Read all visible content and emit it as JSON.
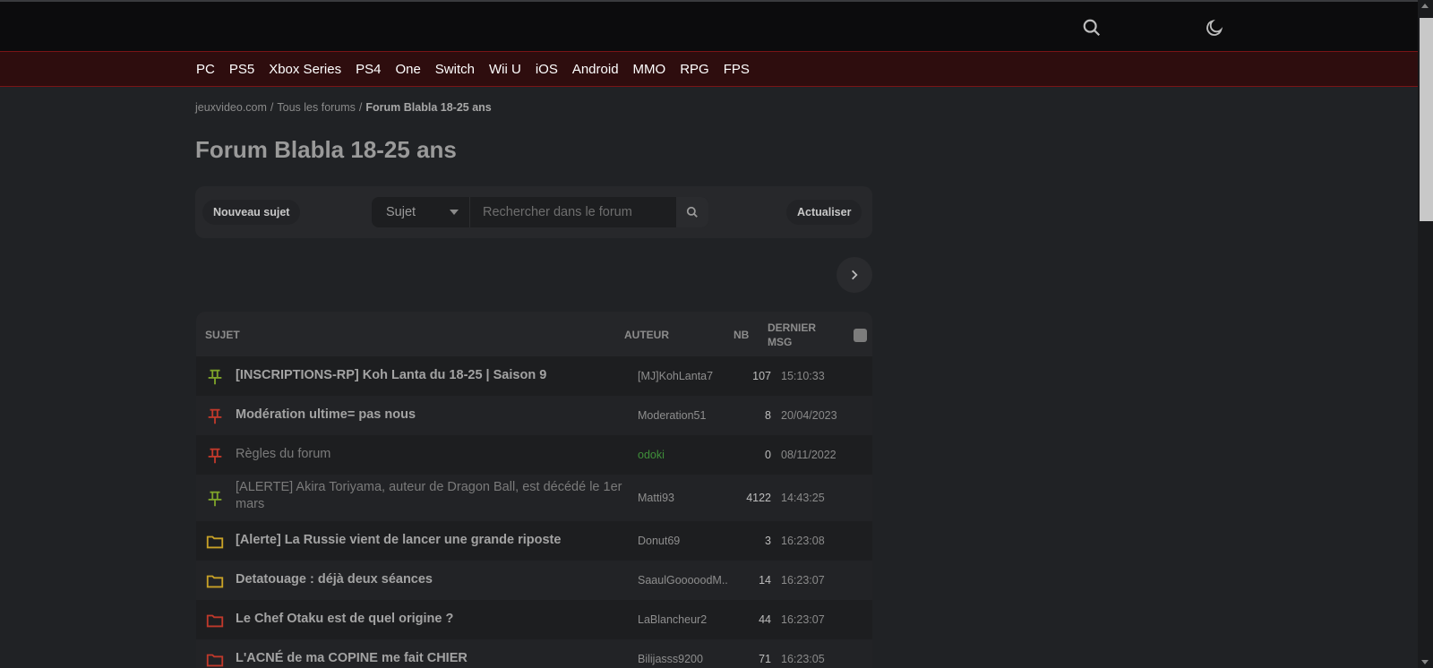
{
  "platforms": [
    "PC",
    "PS5",
    "Xbox Series",
    "PS4",
    "One",
    "Switch",
    "Wii U",
    "iOS",
    "Android",
    "MMO",
    "RPG",
    "FPS"
  ],
  "breadcrumb": {
    "home": "jeuxvideo.com",
    "sep": "/",
    "forums": "Tous les forums",
    "current": "Forum Blabla 18-25 ans"
  },
  "page_title": "Forum Blabla 18-25 ans",
  "actions": {
    "new_topic": "Nouveau sujet",
    "select_value": "Sujet",
    "search_placeholder": "Rechercher dans le forum",
    "refresh": "Actualiser"
  },
  "table": {
    "headers": {
      "subject": "SUJET",
      "author": "AUTEUR",
      "nb": "NB",
      "last_line1": "DERNIER",
      "last_line2": "MSG"
    },
    "rows": [
      {
        "icon": "pin-green",
        "title": "[INSCRIPTIONS-RP] Koh Lanta du 18-25 | Saison 9",
        "author": "[MJ]KohLanta7",
        "nb": "107",
        "last": "15:10:33"
      },
      {
        "icon": "pin-red",
        "title": "Modération ultime= pas nous",
        "author": "Moderation51",
        "nb": "8",
        "last": "20/04/2023"
      },
      {
        "icon": "pin-red",
        "title": "Règles du forum",
        "author": "odoki",
        "nb": "0",
        "last": "08/11/2022"
      },
      {
        "icon": "pin-green",
        "title": "[ALERTE] Akira Toriyama, auteur de Dragon Ball, est décédé le 1er mars",
        "author": "Matti93",
        "nb": "4122",
        "last": "14:43:25"
      },
      {
        "icon": "folder-yellow",
        "title": "[Alerte] La Russie vient de lancer une grande riposte",
        "author": "Donut69",
        "nb": "3",
        "last": "16:23:08"
      },
      {
        "icon": "folder-yellow",
        "title": "Detatouage : déjà deux séances",
        "author": "SaaulGooooodM...",
        "nb": "14",
        "last": "16:23:07"
      },
      {
        "icon": "folder-red",
        "title": "Le Chef Otaku est de quel origine ?",
        "author": "LaBlancheur2",
        "nb": "44",
        "last": "16:23:07"
      },
      {
        "icon": "folder-red",
        "title": "L'ACNÉ de ma COPINE me fait CHIER",
        "author": "Bilijasss9200",
        "nb": "71",
        "last": "16:23:05"
      }
    ]
  },
  "colors": {
    "pin_green": "#7ea32a",
    "pin_red": "#c0392b",
    "folder_yellow": "#c9a227",
    "folder_red": "#c0392b",
    "author_green": "#3f8f3a"
  }
}
